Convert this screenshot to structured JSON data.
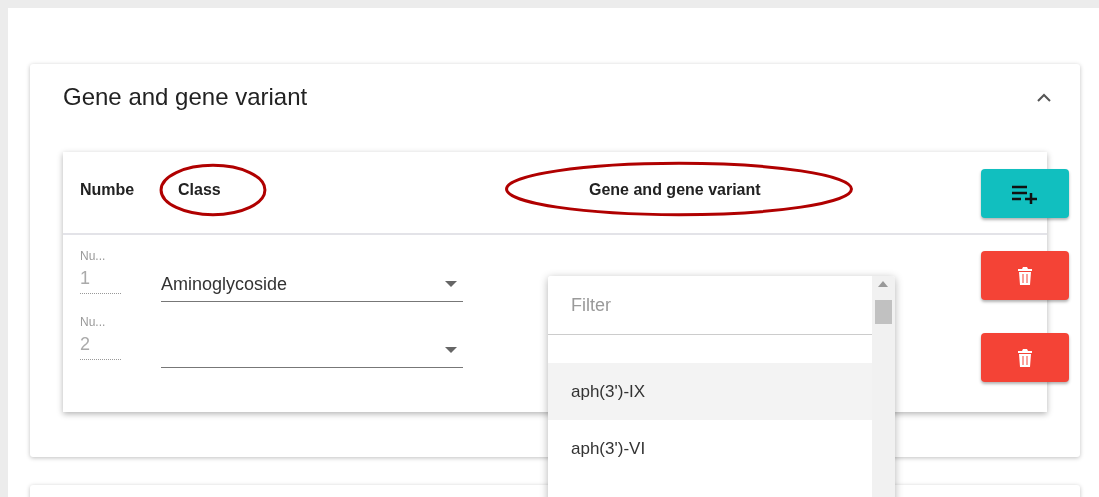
{
  "section": {
    "title": "Gene and gene variant",
    "expanded": true
  },
  "table": {
    "columns": [
      {
        "label": "Numbe"
      },
      {
        "label": "Class",
        "circled": true
      },
      {
        "label": "Gene and gene variant",
        "circled": true
      }
    ],
    "rows": [
      {
        "number_label": "Nu...",
        "number": "1",
        "class": "Aminoglycoside"
      },
      {
        "number_label": "Nu...",
        "number": "2"
      }
    ]
  },
  "dropdown": {
    "placeholder": "Filter",
    "options": [
      {
        "label": "aph(3')-IX",
        "selected": true
      },
      {
        "label": "aph(3')-VI",
        "selected": false
      }
    ]
  }
}
